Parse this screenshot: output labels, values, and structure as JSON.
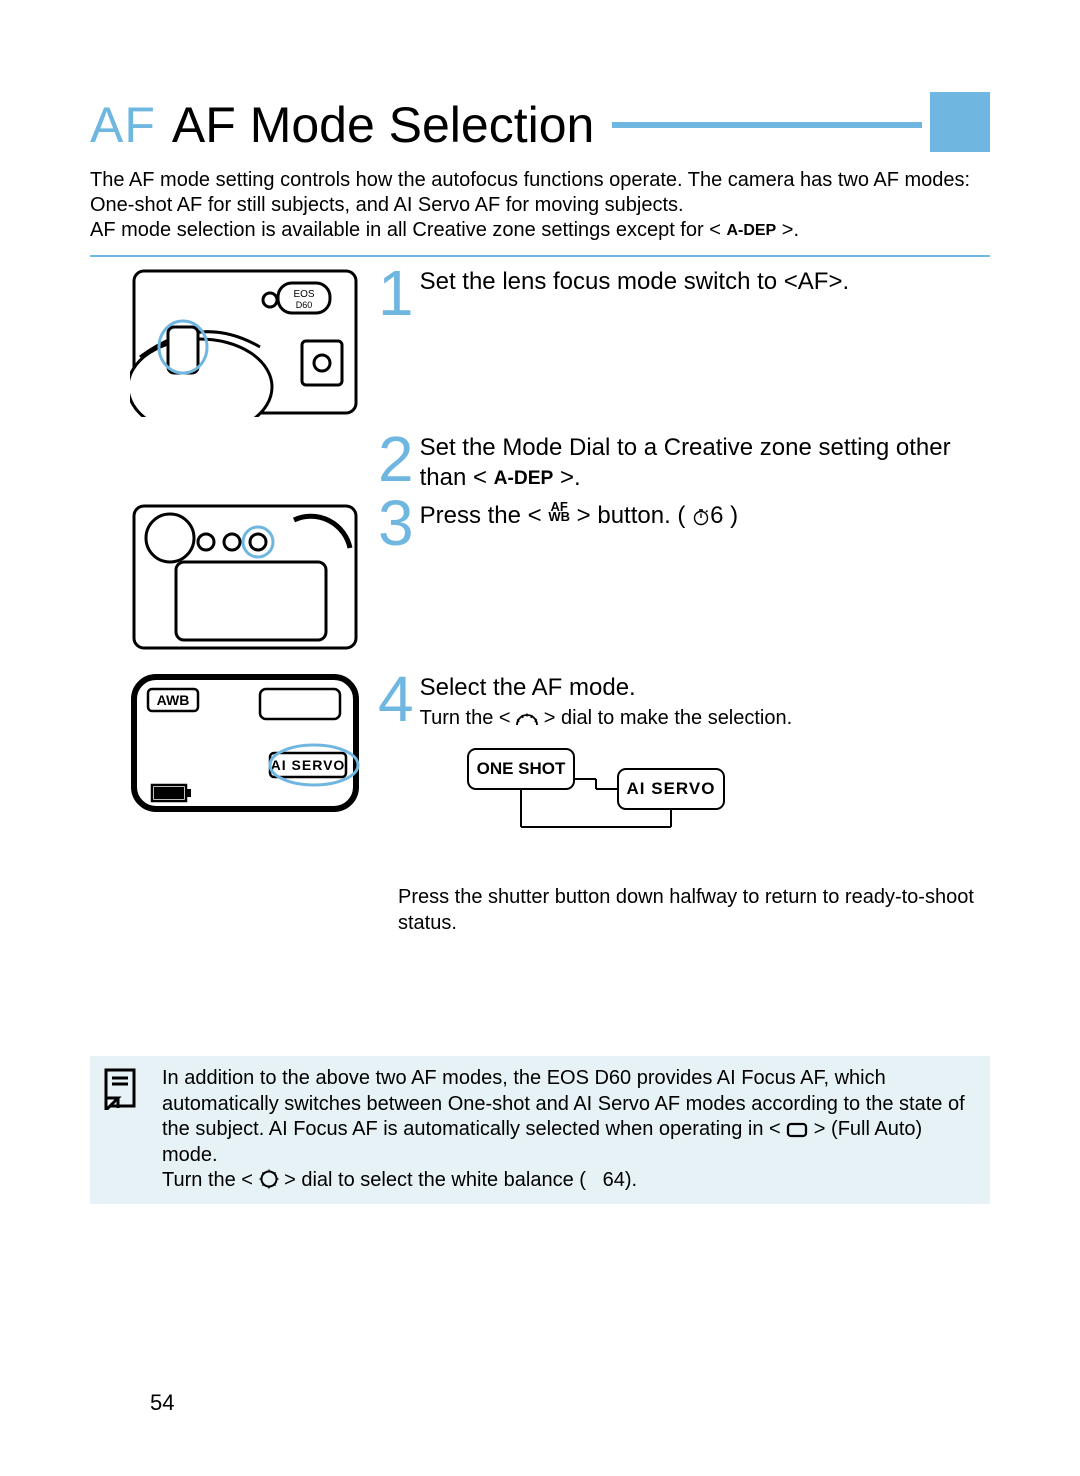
{
  "page": {
    "number": "54"
  },
  "heading": {
    "prefix": "AF",
    "title": "AF Mode Selection"
  },
  "intro": {
    "line1": "The AF mode setting controls how the autofocus functions operate. The camera has two AF modes: One-shot AF for still subjects, and AI Servo AF for moving subjects.",
    "line2_pre": "AF mode selection is available in all Creative zone settings except for < ",
    "line2_icon": "A-DEP",
    "line2_post": " >."
  },
  "steps": {
    "s1": {
      "n": "1",
      "head": "Set the lens focus mode switch to <AF>."
    },
    "s2": {
      "n": "2",
      "head_pre": "Set the Mode Dial to a Creative zone setting other than   < ",
      "head_icon": "A-DEP",
      "head_post": " >."
    },
    "s3": {
      "n": "3",
      "head_pre": "Press the < ",
      "btn_top": "AF",
      "btn_bot": "WB",
      "head_mid": " > button. ( ",
      "timer_val": "6",
      "head_post": " )"
    },
    "s4": {
      "n": "4",
      "head": "Select the AF mode.",
      "sub_pre": "Turn the < ",
      "sub_post": " > dial to make the selection.",
      "mode_a": "ONE SHOT",
      "mode_b": "AI  SERVO",
      "ret": "Press the shutter button down halfway to return to ready-to-shoot status."
    }
  },
  "lcd": {
    "awb": "AWB",
    "ai_servo": "AI SERVO",
    "eos_label": "EOS D60"
  },
  "note": {
    "body_pre": "In addition to the above two AF modes, the EOS D60 provides AI Focus AF, which automatically switches between One-shot and AI Servo AF modes according to the state of the subject. AI Focus AF is automatically selected when operating in <",
    "body_mid": "> (Full Auto) mode.",
    "wb_pre": "Turn the <",
    "wb_mid": "> dial to select the white balance (",
    "wb_page": "64",
    "wb_post": ")."
  }
}
